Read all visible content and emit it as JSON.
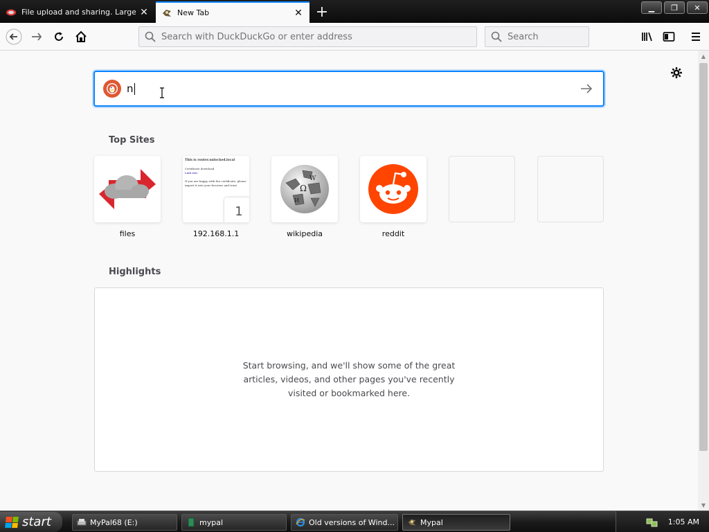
{
  "tabs": [
    {
      "title": "File upload and sharing. Large file",
      "active": false
    },
    {
      "title": "New Tab",
      "active": true
    }
  ],
  "navbar": {
    "url_placeholder": "Search with DuckDuckGo or enter address",
    "search_placeholder": "Search"
  },
  "content": {
    "search_value": "n",
    "top_sites_title": "Top Sites",
    "top_sites": [
      {
        "label": "files"
      },
      {
        "label": "192.168.1.1",
        "badge": "1"
      },
      {
        "label": "wikipedia"
      },
      {
        "label": "reddit"
      },
      {
        "label": ""
      },
      {
        "label": ""
      }
    ],
    "router_thumb": {
      "heading": "This is router.unlocked.local",
      "line1": "Certificate download",
      "line2": "Link text",
      "line3": "If you are happy with the certificate, please import it into your browser and trust"
    },
    "highlights_title": "Highlights",
    "highlights_message": "Start browsing, and we'll show some of the great articles, videos, and other pages you've recently visited or bookmarked here."
  },
  "taskbar": {
    "start_label": "start",
    "tasks": [
      {
        "label": "MyPal68 (E:)"
      },
      {
        "label": "mypal"
      },
      {
        "label": "Old versions of Wind..."
      },
      {
        "label": "Mypal",
        "active": true
      }
    ],
    "clock": "1:05 AM"
  },
  "colors": {
    "accent": "#0a84ff",
    "reddit": "#ff4500",
    "duckduckgo": "#de5833"
  }
}
